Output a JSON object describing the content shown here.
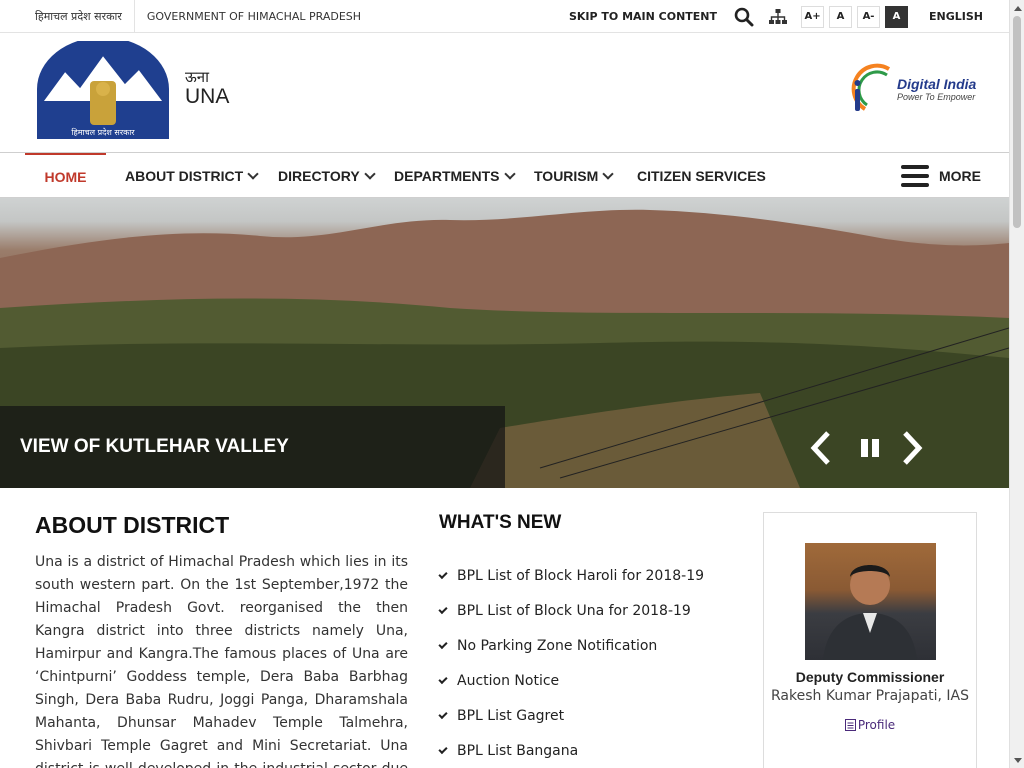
{
  "topbar": {
    "govt_hindi": "हिमाचल प्रदेश सरकार",
    "govt_english": "GOVERNMENT OF HIMACHAL PRADESH",
    "skip_label": "SKIP TO MAIN CONTENT",
    "font_increase": "A+",
    "font_normal": "A",
    "font_decrease": "A-",
    "contrast": "A",
    "language": "ENGLISH"
  },
  "header": {
    "district_hindi": "ऊना",
    "district_english": "UNA",
    "emblem_text": "हिमाचल प्रदेश सरकार",
    "digital_india_title": "Digital India",
    "digital_india_tagline": "Power To Empower"
  },
  "nav": {
    "items": [
      {
        "label": "HOME"
      },
      {
        "label": "ABOUT DISTRICT"
      },
      {
        "label": "DIRECTORY"
      },
      {
        "label": "DEPARTMENTS"
      },
      {
        "label": "TOURISM"
      },
      {
        "label": "CITIZEN SERVICES"
      }
    ],
    "more_label": "MORE"
  },
  "hero": {
    "caption": "VIEW OF KUTLEHAR VALLEY"
  },
  "about": {
    "heading": "ABOUT DISTRICT",
    "body": "Una is a district of Himachal Pradesh which lies in its south western part. On the 1st September,1972 the Himachal Pradesh Govt. reorganised the then Kangra district into three districts namely Una, Hamirpur and Kangra.The famous places of Una are ‘Chintpurni’ Goddess temple, Dera Baba Barbhag Singh, Dera Baba Rudru, Joggi Panga, Dharamshala Mahanta, Dhunsar Mahadev Temple Talmehra, Shivbari Temple Gagret and Mini Secretariat. Una district is well developed in the industrial sector due to proximity to Punjab"
  },
  "news": {
    "heading": "WHAT'S NEW",
    "items": [
      "BPL List of Block Haroli for 2018-19",
      "BPL List of Block Una for 2018-19",
      "No Parking Zone Notification",
      "Auction Notice",
      "BPL List Gagret",
      "BPL List Bangana"
    ]
  },
  "dc": {
    "title": "Deputy Commissioner",
    "name": "Rakesh Kumar Prajapati, IAS",
    "profile_label": "Profile"
  },
  "colors": {
    "accent_red": "#c0392b",
    "digital_india_blue": "#243b8b",
    "profile_purple": "#4a2a7a"
  }
}
